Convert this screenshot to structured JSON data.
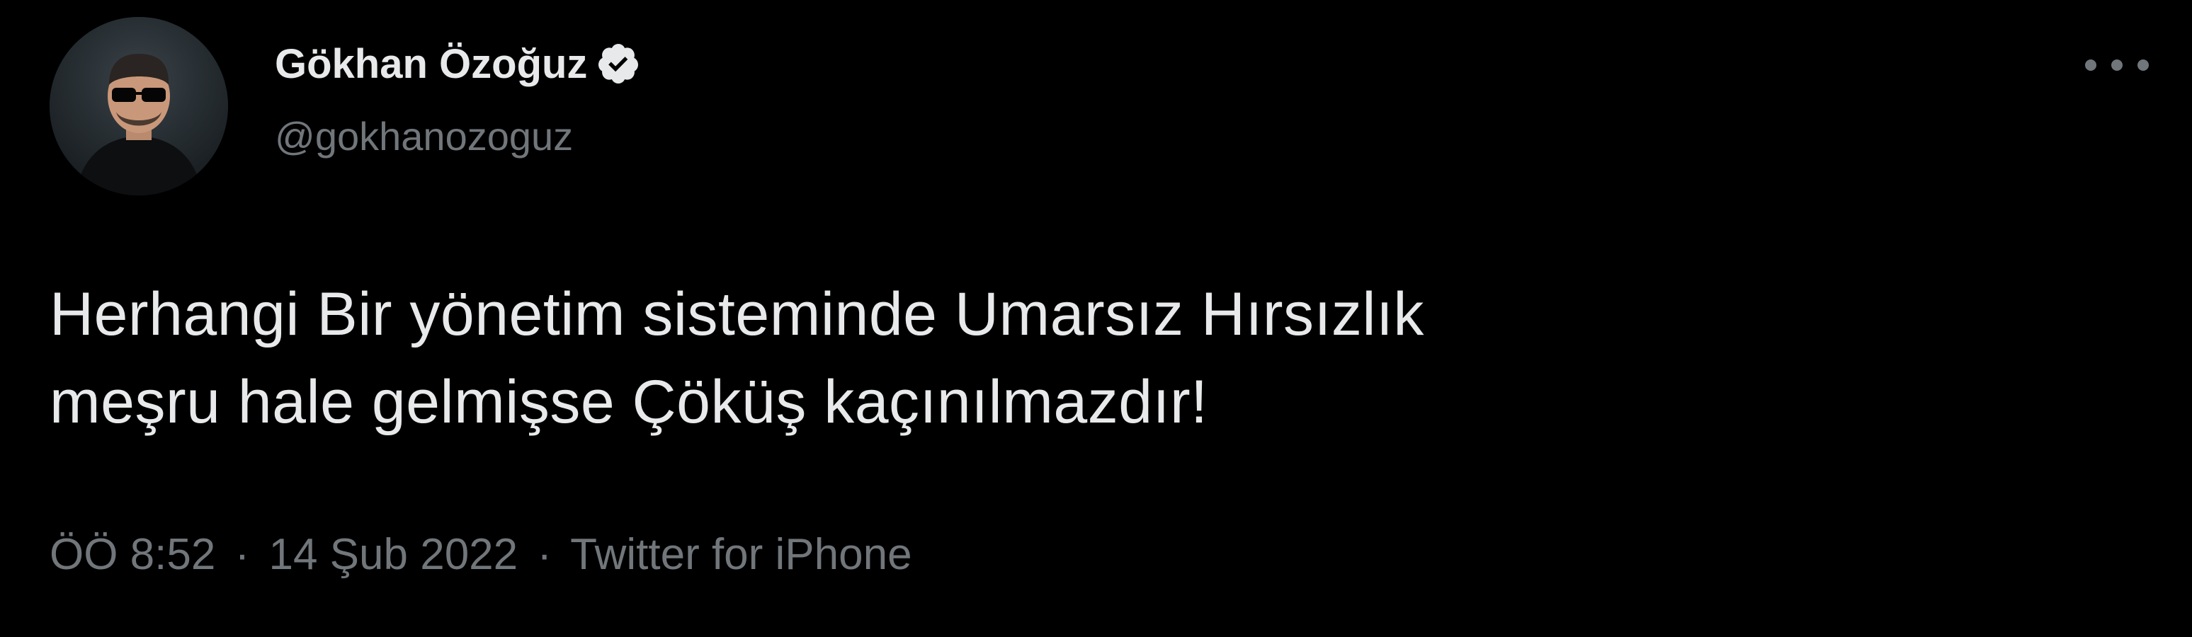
{
  "author": {
    "display_name": "Gökhan Özoğuz",
    "handle": "@gokhanozoguz",
    "verified": true,
    "avatar_icon": "profile-photo-sunglasses"
  },
  "tweet": {
    "text_lines": [
      "Herhangi Bir yönetim sisteminde Umarsız Hırsızlık",
      "meşru hale gelmişse Çöküş kaçınılmazdır!"
    ]
  },
  "meta": {
    "time": "ÖÖ 8:52",
    "separator": "·",
    "date": "14 Şub 2022",
    "source": "Twitter for iPhone"
  },
  "icons": {
    "verified": "verified-badge-icon",
    "more": "more-options-icon"
  },
  "colors": {
    "background": "#000000",
    "text_primary": "#e7e9ea",
    "text_secondary": "#71767b"
  }
}
